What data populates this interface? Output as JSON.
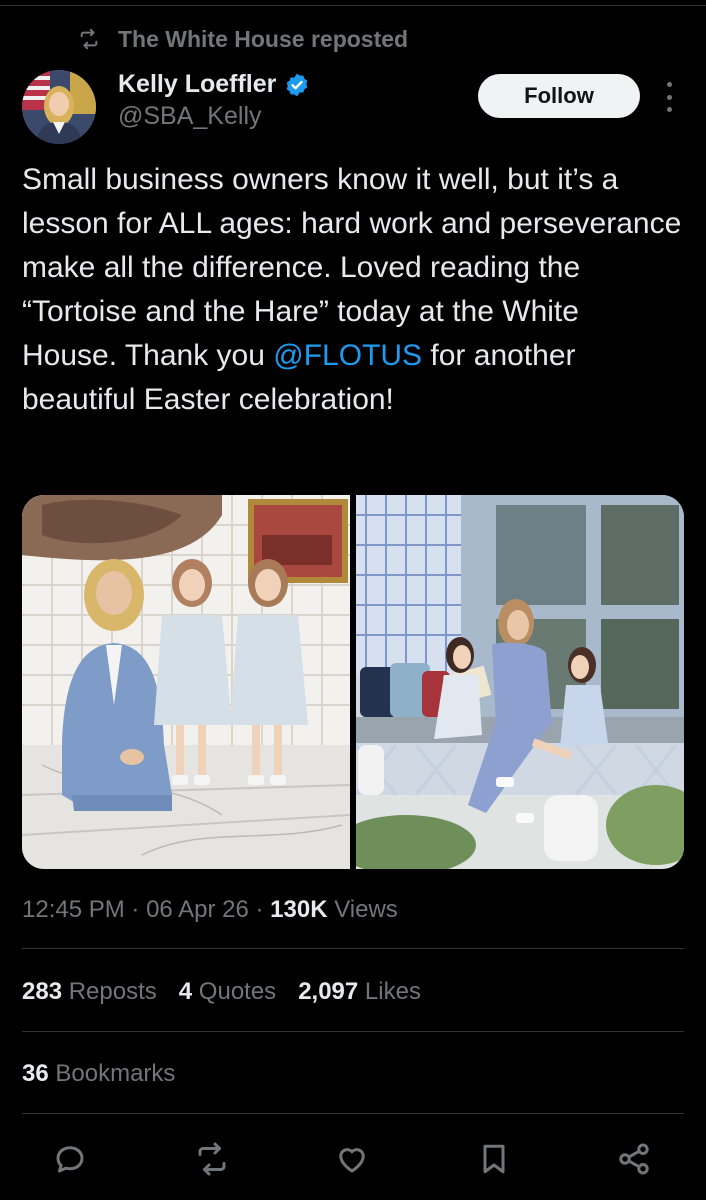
{
  "repost_banner": {
    "text": "The White House reposted",
    "icon": "repost-icon"
  },
  "author": {
    "display_name": "Kelly Loeffler",
    "handle": "@SBA_Kelly",
    "verified_icon": "verified-badge-icon",
    "verified_color": "#1d9bf0"
  },
  "follow_button": {
    "label": "Follow"
  },
  "tweet": {
    "text_before_mention": "Small business owners know it well, but it’s a lesson for ALL ages: hard work and perseverance make all the difference. Loved reading the “Tortoise and the Hare” today at the White House. Thank you ",
    "mention": "@FLOTUS",
    "text_after_mention": " for another beautiful Easter celebration!",
    "mention_color": "#1d9bf0"
  },
  "media": {
    "count": 2,
    "images": [
      "photo-woman-kneeling-with-two-girls",
      "photo-reading-on-bench-with-children"
    ]
  },
  "meta": {
    "time": "12:45 PM",
    "date": "06 Apr 26",
    "views_count": "130K",
    "views_label": "Views"
  },
  "stats": {
    "reposts_count": "283",
    "reposts_label": "Reposts",
    "quotes_count": "4",
    "quotes_label": "Quotes",
    "likes_count": "2,097",
    "likes_label": "Likes",
    "bookmarks_count": "36",
    "bookmarks_label": "Bookmarks"
  },
  "actions": [
    "reply-icon",
    "repost-icon",
    "like-icon",
    "bookmark-icon",
    "share-icon"
  ],
  "colors": {
    "background": "#000000",
    "text": "#e7e9ea",
    "muted": "#71767b",
    "divider": "#2f3336",
    "accent": "#1d9bf0"
  }
}
